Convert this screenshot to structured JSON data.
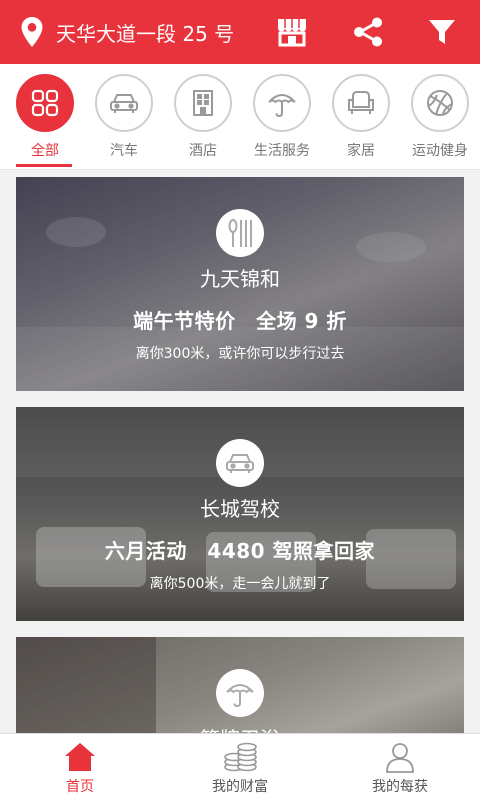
{
  "header": {
    "location": "天华大道一段 25 号",
    "icons": [
      "location-pin-icon",
      "shop-icon",
      "share-icon",
      "filter-icon"
    ],
    "color": "#e8323c"
  },
  "categories": [
    {
      "label": "全部",
      "icon": "grid-icon",
      "active": true
    },
    {
      "label": "汽车",
      "icon": "car-icon",
      "active": false
    },
    {
      "label": "酒店",
      "icon": "building-icon",
      "active": false
    },
    {
      "label": "生活服务",
      "icon": "umbrella-icon",
      "active": false
    },
    {
      "label": "家居",
      "icon": "armchair-icon",
      "active": false
    },
    {
      "label": "运动健身",
      "icon": "basketball-icon",
      "active": false
    }
  ],
  "cards": [
    {
      "icon": "utensils-icon",
      "name": "九天锦和",
      "promo": "端午节特价　全场 9 折",
      "distance": "离你300米，或许你可以步行过去"
    },
    {
      "icon": "car-icon",
      "name": "长城驾校",
      "promo": "六月活动　4480 驾照拿回家",
      "distance": "离你500米，走一会儿就到了"
    },
    {
      "icon": "umbrella-icon",
      "name": "篮牌卫浴",
      "promo": "",
      "distance": ""
    }
  ],
  "bottom_nav": [
    {
      "label": "首页",
      "icon": "home-icon",
      "active": true
    },
    {
      "label": "我的财富",
      "icon": "coins-icon",
      "active": false
    },
    {
      "label": "我的每获",
      "icon": "user-icon",
      "active": false
    }
  ]
}
